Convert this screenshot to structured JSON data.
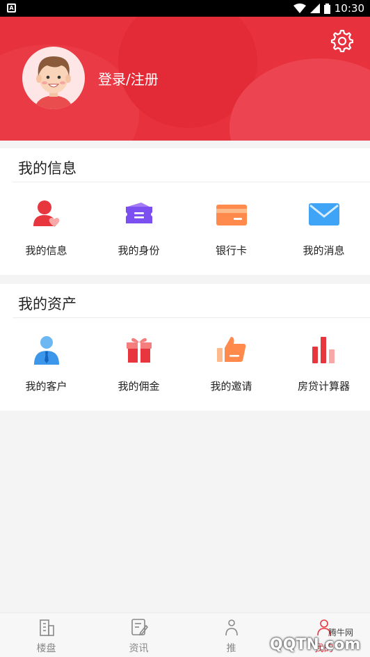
{
  "status_bar": {
    "time": "10:30",
    "app_badge": "A"
  },
  "header": {
    "login_label": "登录/注册",
    "bg_color": "#e7323e"
  },
  "section_info": {
    "title": "我的信息",
    "items": [
      {
        "label": "我的信息",
        "icon": "user-heart-icon"
      },
      {
        "label": "我的身份",
        "icon": "id-ticket-icon"
      },
      {
        "label": "银行卡",
        "icon": "bank-card-icon"
      },
      {
        "label": "我的消息",
        "icon": "envelope-icon"
      }
    ]
  },
  "section_assets": {
    "title": "我的资产",
    "items": [
      {
        "label": "我的客户",
        "icon": "client-icon"
      },
      {
        "label": "我的佣金",
        "icon": "gift-icon"
      },
      {
        "label": "我的邀请",
        "icon": "thumbs-up-icon"
      },
      {
        "label": "房贷计算器",
        "icon": "bar-chart-icon"
      }
    ]
  },
  "tabbar": {
    "tabs": [
      {
        "label": "楼盘",
        "icon": "building-icon"
      },
      {
        "label": "资讯",
        "icon": "news-edit-icon"
      },
      {
        "label": "推",
        "icon": "recommend-icon"
      },
      {
        "label": "我的",
        "icon": "profile-icon"
      }
    ]
  },
  "watermark": {
    "brand": "QQTN.com",
    "brand_cn": "腾牛网"
  }
}
